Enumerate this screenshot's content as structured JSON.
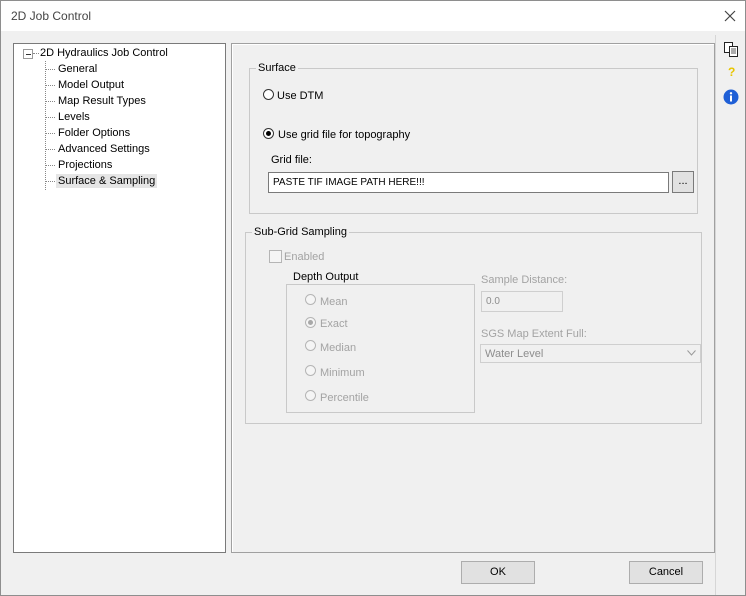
{
  "window": {
    "title": "2D Job Control"
  },
  "tree": {
    "root": "2D Hydraulics Job Control",
    "items": [
      {
        "label": "General"
      },
      {
        "label": "Model Output"
      },
      {
        "label": "Map Result Types"
      },
      {
        "label": "Levels"
      },
      {
        "label": "Folder Options"
      },
      {
        "label": "Advanced Settings"
      },
      {
        "label": "Projections"
      },
      {
        "label": "Surface & Sampling",
        "selected": true
      }
    ]
  },
  "surface": {
    "group_title": "Surface",
    "option_dtm": "Use DTM",
    "option_grid": "Use grid file for topography",
    "selected": "grid",
    "grid_file_label": "Grid file:",
    "grid_file_value": "PASTE TIF IMAGE PATH HERE!!!",
    "browse_label": "..."
  },
  "subgrid": {
    "group_title": "Sub-Grid Sampling",
    "enabled_label": "Enabled",
    "enabled_checked": false,
    "depth_output": {
      "title": "Depth Output",
      "options": [
        "Mean",
        "Exact",
        "Median",
        "Minimum",
        "Percentile"
      ],
      "selected": "Exact"
    },
    "sample_distance_label": "Sample Distance:",
    "sample_distance_value": "0.0",
    "extent_label": "SGS Map Extent Full:",
    "extent_value": "Water Level"
  },
  "side_tools": [
    "copy-icon",
    "help-icon",
    "info-icon"
  ],
  "buttons": {
    "ok": "OK",
    "cancel": "Cancel"
  },
  "colors": {
    "info_blue": "#1f5fd6",
    "help_yellow": "#e8c500"
  }
}
